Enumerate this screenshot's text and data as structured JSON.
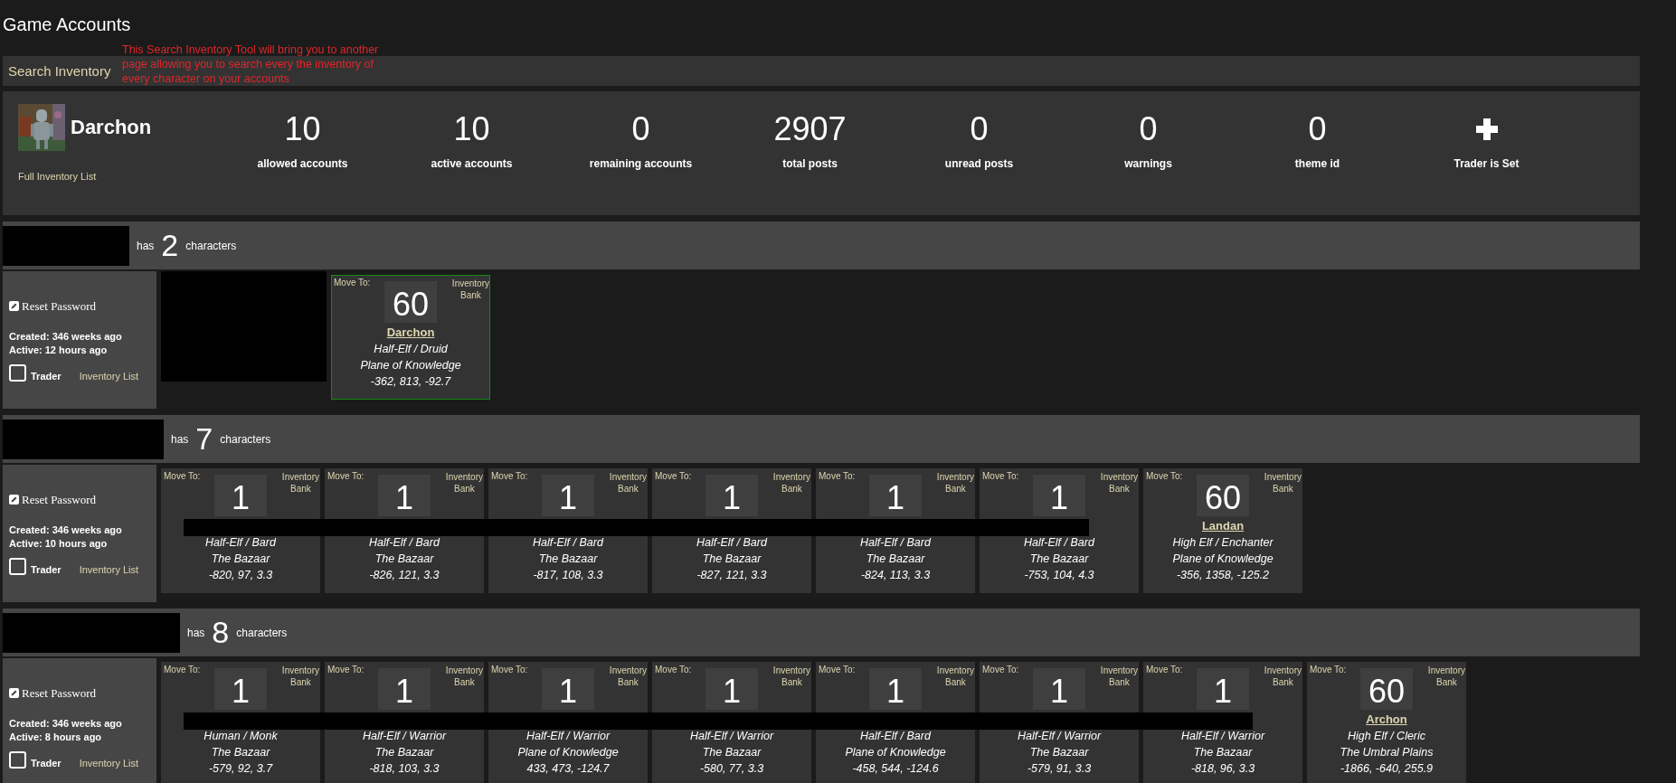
{
  "page_title": "Game Accounts",
  "search_link": "Search Inventory",
  "annotation": "This Search Inventory Tool will bring you to another page allowing you to search every the inventory of every character on your accounts",
  "profile": {
    "name": "Darchon",
    "inventory_link": "Full Inventory List",
    "stats": [
      {
        "kind": "number",
        "value": "10",
        "label": "allowed accounts"
      },
      {
        "kind": "number",
        "value": "10",
        "label": "active accounts"
      },
      {
        "kind": "number",
        "value": "0",
        "label": "remaining accounts"
      },
      {
        "kind": "number",
        "value": "2907",
        "label": "total posts"
      },
      {
        "kind": "number",
        "value": "0",
        "label": "unread posts"
      },
      {
        "kind": "number",
        "value": "0",
        "label": "warnings"
      },
      {
        "kind": "number",
        "value": "0",
        "label": "theme id"
      },
      {
        "kind": "plus",
        "label": "Trader is Set"
      }
    ]
  },
  "accounts": [
    {
      "name_redacted": true,
      "prefix": "has",
      "count": "2",
      "suffix": "characters",
      "reset": "Reset Password",
      "created": "Created: 346 weeks ago",
      "active": "Active: 12 hours ago",
      "trader": {
        "label": "Trader",
        "checked": false
      },
      "inventory_link": "Inventory List",
      "characters": [
        {
          "kind": "redacted"
        },
        {
          "kind": "card",
          "highlighted": true,
          "move_to": "Move To:",
          "inventory": "Inventory",
          "bank": "Bank",
          "level": "60",
          "name": "Darchon",
          "race_class": "Half-Elf / Druid",
          "zone": "Plane of Knowledge",
          "coords": "-362, 813, -92.7"
        }
      ]
    },
    {
      "name_redacted": true,
      "prefix": "has",
      "count": "7",
      "suffix": "characters",
      "reset": "Reset Password",
      "created": "Created: 346 weeks ago",
      "active": "Active: 10 hours ago",
      "trader": {
        "label": "Trader",
        "checked": false
      },
      "inventory_link": "Inventory List",
      "characters": [
        {
          "kind": "card",
          "highlighted": false,
          "name_redacted": true,
          "move_to": "Move To:",
          "inventory": "Inventory",
          "bank": "Bank",
          "level": "1",
          "race_class": "Half-Elf / Bard",
          "zone": "The Bazaar",
          "coords": "-820, 97, 3.3"
        },
        {
          "kind": "card",
          "highlighted": false,
          "name_redacted": true,
          "move_to": "Move To:",
          "inventory": "Inventory",
          "bank": "Bank",
          "level": "1",
          "race_class": "Half-Elf / Bard",
          "zone": "The Bazaar",
          "coords": "-826, 121, 3.3"
        },
        {
          "kind": "card",
          "highlighted": false,
          "name_redacted": true,
          "move_to": "Move To:",
          "inventory": "Inventory",
          "bank": "Bank",
          "level": "1",
          "race_class": "Half-Elf / Bard",
          "zone": "The Bazaar",
          "coords": "-817, 108, 3.3"
        },
        {
          "kind": "card",
          "highlighted": false,
          "name_redacted": true,
          "move_to": "Move To:",
          "inventory": "Inventory",
          "bank": "Bank",
          "level": "1",
          "race_class": "Half-Elf / Bard",
          "zone": "The Bazaar",
          "coords": "-827, 121, 3.3"
        },
        {
          "kind": "card",
          "highlighted": false,
          "name_redacted": true,
          "move_to": "Move To:",
          "inventory": "Inventory",
          "bank": "Bank",
          "level": "1",
          "race_class": "Half-Elf / Bard",
          "zone": "The Bazaar",
          "coords": "-824, 113, 3.3"
        },
        {
          "kind": "card",
          "highlighted": false,
          "name_redacted": true,
          "move_to": "Move To:",
          "inventory": "Inventory",
          "bank": "Bank",
          "level": "1",
          "race_class": "Half-Elf / Bard",
          "zone": "The Bazaar",
          "coords": "-753, 104, 4.3"
        },
        {
          "kind": "card",
          "highlighted": false,
          "move_to": "Move To:",
          "inventory": "Inventory",
          "bank": "Bank",
          "level": "60",
          "name": "Landan",
          "race_class": "High Elf / Enchanter",
          "zone": "Plane of Knowledge",
          "coords": "-356, 1358, -125.2"
        }
      ]
    },
    {
      "name_redacted": true,
      "prefix": "has",
      "count": "8",
      "suffix": "characters",
      "reset": "Reset Password",
      "created": "Created: 346 weeks ago",
      "active": "Active: 8 hours ago",
      "trader": {
        "label": "Trader",
        "checked": false
      },
      "inventory_link": "Inventory List",
      "characters": [
        {
          "kind": "card",
          "highlighted": false,
          "name_redacted": true,
          "move_to": "Move To:",
          "inventory": "Inventory",
          "bank": "Bank",
          "level": "1",
          "race_class": "Human / Monk",
          "zone": "The Bazaar",
          "coords": "-579, 92, 3.7"
        },
        {
          "kind": "card",
          "highlighted": false,
          "name_redacted": true,
          "move_to": "Move To:",
          "inventory": "Inventory",
          "bank": "Bank",
          "level": "1",
          "race_class": "Half-Elf / Warrior",
          "zone": "The Bazaar",
          "coords": "-818, 103, 3.3"
        },
        {
          "kind": "card",
          "highlighted": false,
          "name_redacted": true,
          "move_to": "Move To:",
          "inventory": "Inventory",
          "bank": "Bank",
          "level": "1",
          "race_class": "Half-Elf / Warrior",
          "zone": "Plane of Knowledge",
          "coords": "433, 473, -124.7"
        },
        {
          "kind": "card",
          "highlighted": false,
          "name_redacted": true,
          "move_to": "Move To:",
          "inventory": "Inventory",
          "bank": "Bank",
          "level": "1",
          "race_class": "Half-Elf / Warrior",
          "zone": "The Bazaar",
          "coords": "-580, 77, 3.3"
        },
        {
          "kind": "card",
          "highlighted": false,
          "name_redacted": true,
          "move_to": "Move To:",
          "inventory": "Inventory",
          "bank": "Bank",
          "level": "1",
          "race_class": "Half-Elf / Bard",
          "zone": "Plane of Knowledge",
          "coords": "-458, 544, -124.6"
        },
        {
          "kind": "card",
          "highlighted": false,
          "name_redacted": true,
          "move_to": "Move To:",
          "inventory": "Inventory",
          "bank": "Bank",
          "level": "1",
          "race_class": "Half-Elf / Warrior",
          "zone": "The Bazaar",
          "coords": "-579, 91, 3.3"
        },
        {
          "kind": "card",
          "highlighted": false,
          "name_redacted": true,
          "move_to": "Move To:",
          "inventory": "Inventory",
          "bank": "Bank",
          "level": "1",
          "race_class": "Half-Elf / Warrior",
          "zone": "The Bazaar",
          "coords": "-818, 96, 3.3"
        },
        {
          "kind": "card",
          "highlighted": false,
          "move_to": "Move To:",
          "inventory": "Inventory",
          "bank": "Bank",
          "level": "60",
          "name": "Archon",
          "race_class": "High Elf / Cleric",
          "zone": "The Umbral Plains",
          "coords": "-1866, -640, 255.9"
        }
      ]
    }
  ]
}
